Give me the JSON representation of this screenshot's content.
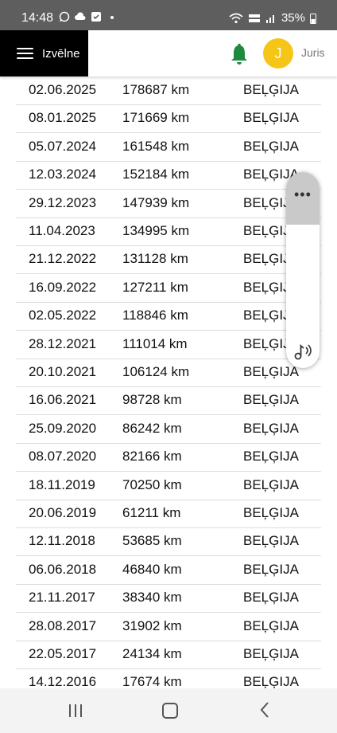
{
  "status_bar": {
    "time": "14:48",
    "battery": "35%",
    "icons": [
      "whatsapp-icon",
      "cloud-icon",
      "checkbox-icon",
      "dot-icon",
      "wifi-icon",
      "volte-icon",
      "signal-icon",
      "battery-icon"
    ]
  },
  "header": {
    "menu_label": "Izvēlne",
    "avatar_initial": "J",
    "user_name": "Juris",
    "accent_color": "#f5c518",
    "bell_color": "#1e8a3e"
  },
  "records": [
    {
      "date": "02.06.2025",
      "km": "178687 km",
      "country": "BEĻĢIJA"
    },
    {
      "date": "08.01.2025",
      "km": "171669 km",
      "country": "BEĻĢIJA"
    },
    {
      "date": "05.07.2024",
      "km": "161548 km",
      "country": "BEĻĢIJA"
    },
    {
      "date": "12.03.2024",
      "km": "152184 km",
      "country": "BEĻĢIJA"
    },
    {
      "date": "29.12.2023",
      "km": "147939 km",
      "country": "BEĻĢIJA"
    },
    {
      "date": "11.04.2023",
      "km": "134995 km",
      "country": "BEĻĢIJA"
    },
    {
      "date": "21.12.2022",
      "km": "131128 km",
      "country": "BEĻĢIJA"
    },
    {
      "date": "16.09.2022",
      "km": "127211 km",
      "country": "BEĻĢIJA"
    },
    {
      "date": "02.05.2022",
      "km": "118846 km",
      "country": "BEĻĢIJA"
    },
    {
      "date": "28.12.2021",
      "km": "111014 km",
      "country": "BEĻĢIJA"
    },
    {
      "date": "20.10.2021",
      "km": "106124 km",
      "country": "BEĻĢIJA"
    },
    {
      "date": "16.06.2021",
      "km": "98728 km",
      "country": "BEĻĢIJA"
    },
    {
      "date": "25.09.2020",
      "km": "86242 km",
      "country": "BEĻĢIJA"
    },
    {
      "date": "08.07.2020",
      "km": "82166 km",
      "country": "BEĻĢIJA"
    },
    {
      "date": "18.11.2019",
      "km": "70250 km",
      "country": "BEĻĢIJA"
    },
    {
      "date": "20.06.2019",
      "km": "61211 km",
      "country": "BEĻĢIJA"
    },
    {
      "date": "12.11.2018",
      "km": "53685 km",
      "country": "BEĻĢIJA"
    },
    {
      "date": "06.06.2018",
      "km": "46840 km",
      "country": "BEĻĢIJA"
    },
    {
      "date": "21.11.2017",
      "km": "38340 km",
      "country": "BEĻĢIJA"
    },
    {
      "date": "28.08.2017",
      "km": "31902 km",
      "country": "BEĻĢIJA"
    },
    {
      "date": "22.05.2017",
      "km": "24134 km",
      "country": "BEĻĢIJA"
    },
    {
      "date": "14.12.2016",
      "km": "17674 km",
      "country": "BEĻĢIJA"
    }
  ],
  "floating_panel": {
    "more_label": "•••",
    "icons": [
      "more-icon",
      "sound-assistant-icon"
    ]
  },
  "nav_bar": {
    "icons": [
      "recent-apps-icon",
      "home-icon",
      "back-icon"
    ]
  }
}
